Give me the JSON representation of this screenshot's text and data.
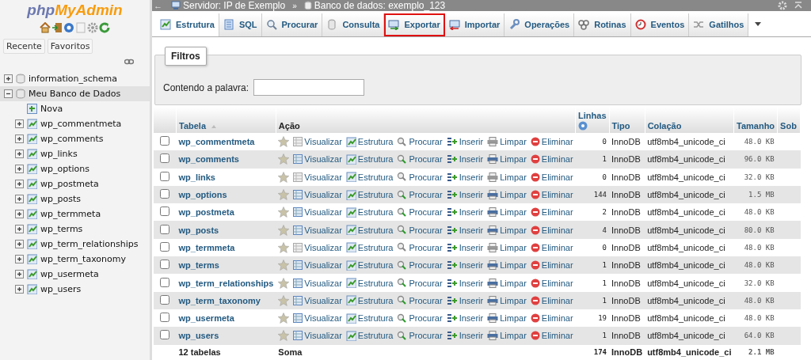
{
  "sidebar": {
    "logo": {
      "part_1": "php",
      "part_2": "MyAdmin"
    },
    "buttons": [
      {
        "label": "Recente"
      },
      {
        "label": "Favoritos"
      }
    ],
    "tree": [
      {
        "label": "information_schema",
        "expanded": false,
        "selected": false
      },
      {
        "label": "Meu Banco de Dados",
        "expanded": true,
        "selected": true,
        "children": [
          {
            "label": "Nova",
            "kind": "new"
          },
          {
            "label": "wp_commentmeta",
            "kind": "table"
          },
          {
            "label": "wp_comments",
            "kind": "table"
          },
          {
            "label": "wp_links",
            "kind": "table"
          },
          {
            "label": "wp_options",
            "kind": "table"
          },
          {
            "label": "wp_postmeta",
            "kind": "table"
          },
          {
            "label": "wp_posts",
            "kind": "table"
          },
          {
            "label": "wp_termmeta",
            "kind": "table"
          },
          {
            "label": "wp_terms",
            "kind": "table"
          },
          {
            "label": "wp_term_relationships",
            "kind": "table"
          },
          {
            "label": "wp_term_taxonomy",
            "kind": "table"
          },
          {
            "label": "wp_usermeta",
            "kind": "table"
          },
          {
            "label": "wp_users",
            "kind": "table"
          }
        ]
      }
    ]
  },
  "back": "←",
  "breadcrumb": [
    {
      "label": "Servidor: IP de Exemplo"
    },
    {
      "label": "Banco de dados: exemplo_123"
    }
  ],
  "breadcrumb_separator": "»",
  "tabs": [
    {
      "label": "Estrutura",
      "selected": true,
      "highlighted": false
    },
    {
      "label": "SQL",
      "selected": false,
      "highlighted": false
    },
    {
      "label": "Procurar",
      "selected": false,
      "highlighted": false
    },
    {
      "label": "Consulta",
      "selected": false,
      "highlighted": false
    },
    {
      "label": "Exportar",
      "selected": false,
      "highlighted": true
    },
    {
      "label": "Importar",
      "selected": false,
      "highlighted": false
    },
    {
      "label": "Operações",
      "selected": false,
      "highlighted": false
    },
    {
      "label": "Rotinas",
      "selected": false,
      "highlighted": false
    },
    {
      "label": "Eventos",
      "selected": false,
      "highlighted": false
    },
    {
      "label": "Gatilhos",
      "selected": false,
      "highlighted": false
    }
  ],
  "filter": {
    "legend": "Filtros",
    "label": "Contendo a palavra:"
  },
  "table": {
    "columns": [
      "Tabela",
      "Ação",
      "Linhas",
      "Tipo",
      "Colação",
      "Tamanho",
      "Sob"
    ],
    "rows": [
      {
        "name": "wp_commentmeta",
        "checked": false,
        "empty": true,
        "actions": [
          "Visualizar",
          "Estrutura",
          "Procurar",
          "Inserir",
          "Limpar",
          "Eliminar"
        ],
        "rows": "0",
        "type": "InnoDB",
        "collation": "utf8mb4_unicode_ci",
        "size": "48.0 KB"
      },
      {
        "name": "wp_comments",
        "checked": false,
        "empty": false,
        "actions": [
          "Visualizar",
          "Estrutura",
          "Procurar",
          "Inserir",
          "Limpar",
          "Eliminar"
        ],
        "rows": "1",
        "type": "InnoDB",
        "collation": "utf8mb4_unicode_ci",
        "size": "96.0 KB"
      },
      {
        "name": "wp_links",
        "checked": false,
        "empty": true,
        "actions": [
          "Visualizar",
          "Estrutura",
          "Procurar",
          "Inserir",
          "Limpar",
          "Eliminar"
        ],
        "rows": "0",
        "type": "InnoDB",
        "collation": "utf8mb4_unicode_ci",
        "size": "32.0 KB"
      },
      {
        "name": "wp_options",
        "checked": false,
        "empty": false,
        "actions": [
          "Visualizar",
          "Estrutura",
          "Procurar",
          "Inserir",
          "Limpar",
          "Eliminar"
        ],
        "rows": "144",
        "type": "InnoDB",
        "collation": "utf8mb4_unicode_ci",
        "size": "1.5 MB"
      },
      {
        "name": "wp_postmeta",
        "checked": false,
        "empty": false,
        "actions": [
          "Visualizar",
          "Estrutura",
          "Procurar",
          "Inserir",
          "Limpar",
          "Eliminar"
        ],
        "rows": "2",
        "type": "InnoDB",
        "collation": "utf8mb4_unicode_ci",
        "size": "48.0 KB"
      },
      {
        "name": "wp_posts",
        "checked": false,
        "empty": false,
        "actions": [
          "Visualizar",
          "Estrutura",
          "Procurar",
          "Inserir",
          "Limpar",
          "Eliminar"
        ],
        "rows": "4",
        "type": "InnoDB",
        "collation": "utf8mb4_unicode_ci",
        "size": "80.0 KB"
      },
      {
        "name": "wp_termmeta",
        "checked": false,
        "empty": true,
        "actions": [
          "Visualizar",
          "Estrutura",
          "Procurar",
          "Inserir",
          "Limpar",
          "Eliminar"
        ],
        "rows": "0",
        "type": "InnoDB",
        "collation": "utf8mb4_unicode_ci",
        "size": "48.0 KB"
      },
      {
        "name": "wp_terms",
        "checked": false,
        "empty": false,
        "actions": [
          "Visualizar",
          "Estrutura",
          "Procurar",
          "Inserir",
          "Limpar",
          "Eliminar"
        ],
        "rows": "1",
        "type": "InnoDB",
        "collation": "utf8mb4_unicode_ci",
        "size": "48.0 KB"
      },
      {
        "name": "wp_term_relationships",
        "checked": false,
        "empty": false,
        "actions": [
          "Visualizar",
          "Estrutura",
          "Procurar",
          "Inserir",
          "Limpar",
          "Eliminar"
        ],
        "rows": "1",
        "type": "InnoDB",
        "collation": "utf8mb4_unicode_ci",
        "size": "32.0 KB"
      },
      {
        "name": "wp_term_taxonomy",
        "checked": false,
        "empty": false,
        "actions": [
          "Visualizar",
          "Estrutura",
          "Procurar",
          "Inserir",
          "Limpar",
          "Eliminar"
        ],
        "rows": "1",
        "type": "InnoDB",
        "collation": "utf8mb4_unicode_ci",
        "size": "48.0 KB"
      },
      {
        "name": "wp_usermeta",
        "checked": false,
        "empty": false,
        "actions": [
          "Visualizar",
          "Estrutura",
          "Procurar",
          "Inserir",
          "Limpar",
          "Eliminar"
        ],
        "rows": "19",
        "type": "InnoDB",
        "collation": "utf8mb4_unicode_ci",
        "size": "48.0 KB"
      },
      {
        "name": "wp_users",
        "checked": false,
        "empty": false,
        "actions": [
          "Visualizar",
          "Estrutura",
          "Procurar",
          "Inserir",
          "Limpar",
          "Eliminar"
        ],
        "rows": "1",
        "type": "InnoDB",
        "collation": "utf8mb4_unicode_ci",
        "size": "64.0 KB"
      }
    ],
    "footer": {
      "count": "12 tabelas",
      "label": "Soma",
      "rows": "174",
      "type": "InnoDB",
      "collation": "utf8mb4_unicode_ci",
      "size": "2.1 MB"
    }
  }
}
